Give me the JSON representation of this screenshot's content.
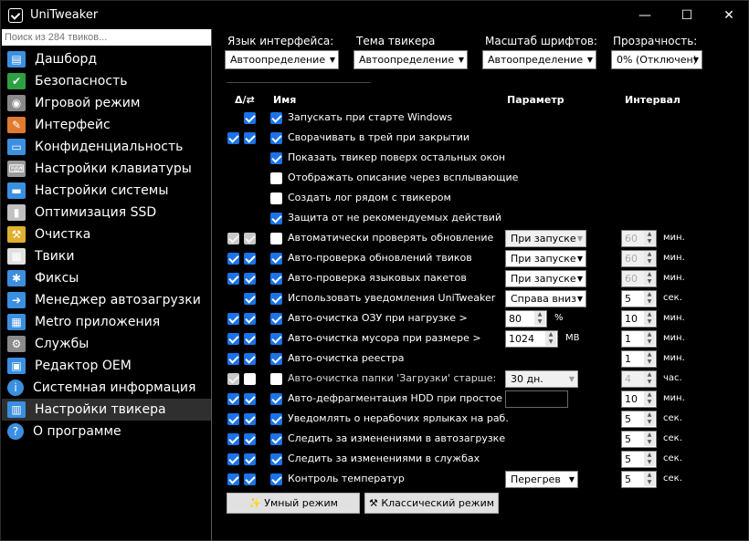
{
  "window": {
    "title": "UniTweaker",
    "minimize": "—",
    "maximize": "☐",
    "close": "✕"
  },
  "sidebar": {
    "search_placeholder": "Поиск из 284 твиков...",
    "items": [
      {
        "label": "Дашборд",
        "icon": "dashboard-icon",
        "color": "#3b8fe0",
        "glyph": "▤"
      },
      {
        "label": "Безопасность",
        "icon": "shield-icon",
        "color": "#2ea043",
        "glyph": "✔"
      },
      {
        "label": "Игровой режим",
        "icon": "gamepad-icon",
        "color": "#8a8a8a",
        "glyph": "◉"
      },
      {
        "label": "Интерфейс",
        "icon": "palette-icon",
        "color": "#e07a2e",
        "glyph": "✎"
      },
      {
        "label": "Конфиденциальность",
        "icon": "monitor-icon",
        "color": "#3b8fe0",
        "glyph": "▭"
      },
      {
        "label": "Настройки клавиатуры",
        "icon": "keyboard-icon",
        "color": "#9a9a9a",
        "glyph": "⌨"
      },
      {
        "label": "Настройки системы",
        "icon": "laptop-icon",
        "color": "#3b8fe0",
        "glyph": "▬"
      },
      {
        "label": "Оптимизация SSD",
        "icon": "ssd-icon",
        "color": "#c0c0c0",
        "glyph": "▮"
      },
      {
        "label": "Очистка",
        "icon": "broom-icon",
        "color": "#e0b030",
        "glyph": "⚒"
      },
      {
        "label": "Твики",
        "icon": "tweaks-icon",
        "color": "#e0e0e0",
        "glyph": "▦"
      },
      {
        "label": "Фиксы",
        "icon": "wrench-icon",
        "color": "#3b8fe0",
        "glyph": "✱"
      },
      {
        "label": "Менеджер автозагрузки",
        "icon": "startup-icon",
        "color": "#3b8fe0",
        "glyph": "➜"
      },
      {
        "label": "Metro приложения",
        "icon": "metro-icon",
        "color": "#3b8fe0",
        "glyph": "▦"
      },
      {
        "label": "Службы",
        "icon": "gears-icon",
        "color": "#8a8a8a",
        "glyph": "⚙"
      },
      {
        "label": "Редактор OEM",
        "icon": "oem-icon",
        "color": "#3b8fe0",
        "glyph": "▣"
      },
      {
        "label": "Системная информация",
        "icon": "info-icon",
        "color": "#3b8fe0",
        "glyph": "i"
      },
      {
        "label": "Настройки твикера",
        "icon": "tweaker-settings-icon",
        "color": "#3b8fe0",
        "glyph": "▥"
      },
      {
        "label": "О программе",
        "icon": "help-icon",
        "color": "#3b8fe0",
        "glyph": "?"
      }
    ]
  },
  "top": {
    "language": {
      "label": "Язык интерфейса:",
      "value": "Автоопределение"
    },
    "theme": {
      "label": "Тема твикера",
      "value": "Автоопределение"
    },
    "scale": {
      "label": "Масштаб шрифтов:",
      "value": "Автоопределение"
    },
    "opacity": {
      "label": "Прозрачность:",
      "value": "0% (Отключен)"
    }
  },
  "columns": {
    "flags": "Δ/⇄",
    "name": "Имя",
    "param": "Параметр",
    "interval": "Интервал"
  },
  "rows": [
    {
      "c1": null,
      "c2": "on",
      "main": "on",
      "label": "Запускать при старте Windows"
    },
    {
      "c1": "on",
      "c2": "on",
      "main": "on",
      "label": "Сворачивать в трей при закрытии"
    },
    {
      "c1": null,
      "c2": null,
      "main": "on",
      "label": "Показать твикер поверх остальных окон"
    },
    {
      "c1": null,
      "c2": null,
      "main": "off",
      "label": "Отображать описание через всплывающие"
    },
    {
      "c1": null,
      "c2": null,
      "main": "off",
      "label": "Создать лог рядом с твикером"
    },
    {
      "c1": null,
      "c2": null,
      "main": "on",
      "label": "Защита от не рекомендуемых действий"
    },
    {
      "c1": "gray",
      "c2": "gray",
      "main": "off",
      "label": "Автоматически проверять обновление",
      "param": {
        "type": "drop",
        "value": "При запуске",
        "disabled": true
      },
      "interval": {
        "value": "60",
        "unit": "мин.",
        "disabled": true
      }
    },
    {
      "c1": "on",
      "c2": "on",
      "main": "on",
      "label": "Авто-проверка обновлений твиков",
      "param": {
        "type": "drop",
        "value": "При запуске"
      },
      "interval": {
        "value": "60",
        "unit": "мин.",
        "disabled": true
      }
    },
    {
      "c1": "on",
      "c2": "on",
      "main": "on",
      "label": "Авто-проверка языковых пакетов",
      "param": {
        "type": "drop",
        "value": "При запуске"
      },
      "interval": {
        "value": "60",
        "unit": "мин.",
        "disabled": true
      }
    },
    {
      "c1": null,
      "c2": "on",
      "main": "on",
      "label": "Использовать уведомления UniTweaker",
      "param": {
        "type": "drop",
        "value": "Справа вниз"
      },
      "interval": {
        "value": "5",
        "unit": "сек."
      }
    },
    {
      "c1": "on",
      "c2": "on",
      "main": "on",
      "label": "Авто-очистка ОЗУ при нагрузке >",
      "param": {
        "type": "spin",
        "value": "80",
        "unit": "%",
        "w": 46
      },
      "interval": {
        "value": "10",
        "unit": "мин."
      }
    },
    {
      "c1": "on",
      "c2": "on",
      "main": "on",
      "label": "Авто-очистка мусора при размере >",
      "param": {
        "type": "spin",
        "value": "1024",
        "unit": "MB",
        "w": 58
      },
      "interval": {
        "value": "1",
        "unit": "мин."
      }
    },
    {
      "c1": "on",
      "c2": "on",
      "main": "on",
      "label": "Авто-очистка реестра",
      "interval": {
        "value": "1",
        "unit": "мин."
      }
    },
    {
      "c1": "gray",
      "c2": "off",
      "main": "off",
      "label": "Авто-очистка папки 'Загрузки' старше:",
      "dim": true,
      "param": {
        "type": "drop",
        "value": "30 дн.",
        "disabled": true,
        "w": 80
      },
      "interval": {
        "value": "4",
        "unit": "час.",
        "disabled": true
      }
    },
    {
      "c1": "on",
      "c2": "on",
      "main": "on",
      "label": "Авто-дефрагментация HDD при простое",
      "param": {
        "type": "empty"
      },
      "interval": {
        "value": "10",
        "unit": "мин."
      }
    },
    {
      "c1": "on",
      "c2": "on",
      "main": "on",
      "label": "Уведомлять о нерабочих ярлыках на раб.",
      "interval": {
        "value": "5",
        "unit": "сек."
      }
    },
    {
      "c1": "on",
      "c2": "on",
      "main": "on",
      "label": "Следить за изменениями в автозагрузке",
      "interval": {
        "value": "5",
        "unit": "сек."
      }
    },
    {
      "c1": "on",
      "c2": "on",
      "main": "on",
      "label": "Следить за изменениями в службах",
      "interval": {
        "value": "5",
        "unit": "сек."
      }
    },
    {
      "c1": "on",
      "c2": "on",
      "main": "on",
      "label": "Контроль температур",
      "param": {
        "type": "drop",
        "value": "Перегрев",
        "w": 80
      },
      "interval": {
        "value": "5",
        "unit": "сек."
      }
    }
  ],
  "buttons": {
    "smart": "✨ Умный режим",
    "classic": "⚒ Классический режим"
  }
}
